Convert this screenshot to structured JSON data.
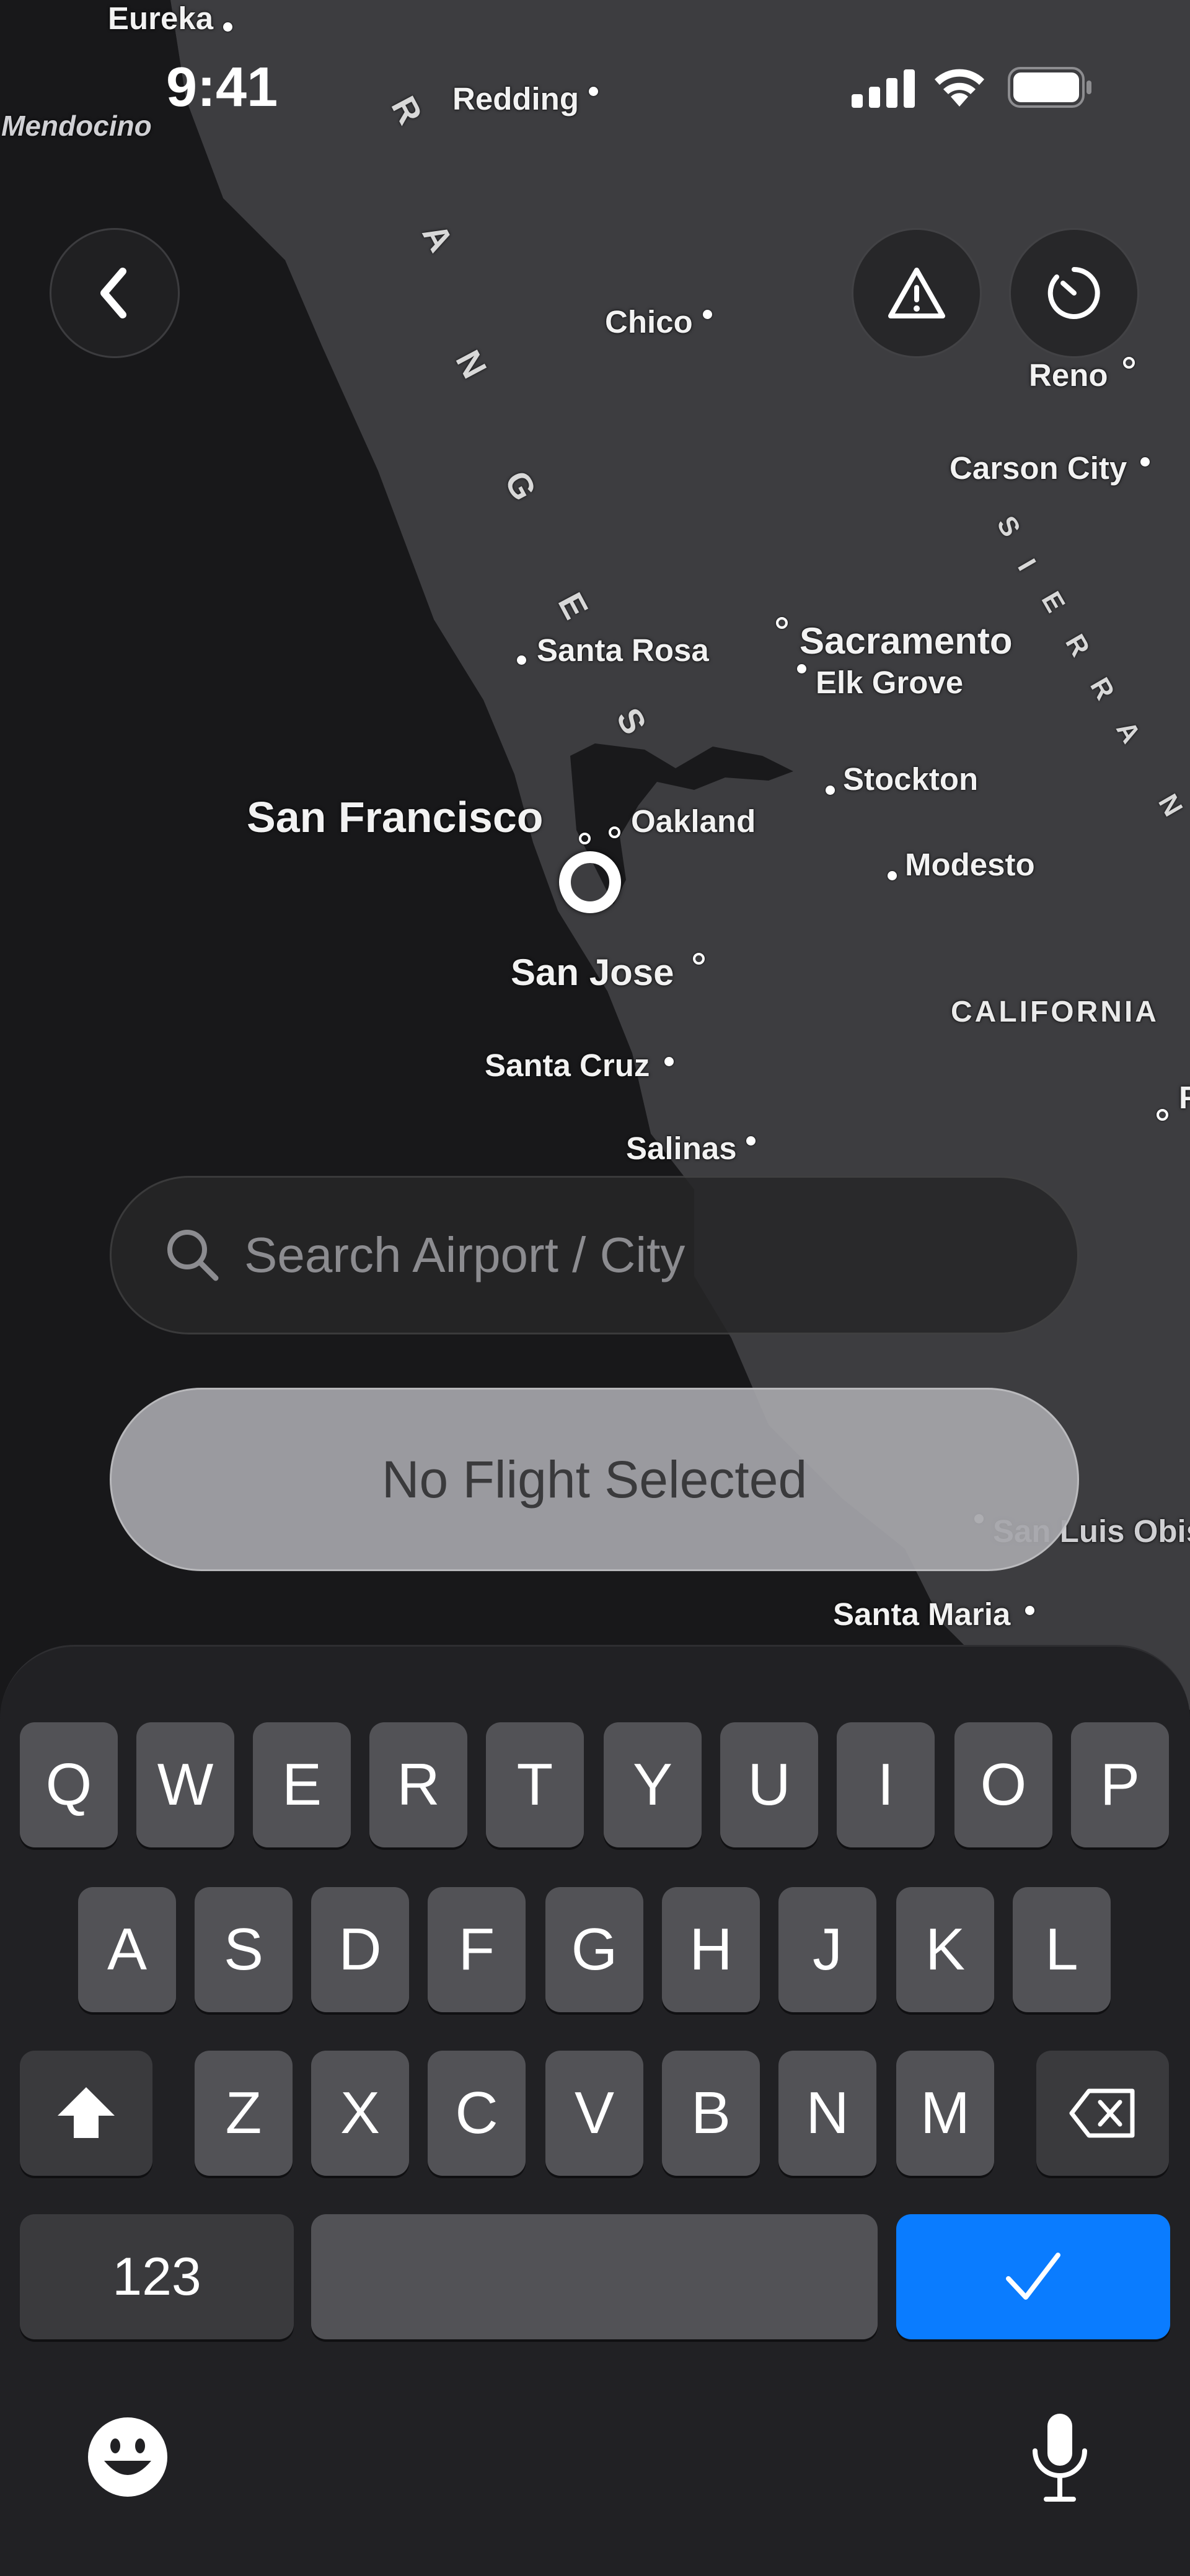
{
  "status_bar": {
    "time": "9:41",
    "icons": [
      "signal-icon",
      "wifi-icon",
      "battery-icon"
    ]
  },
  "map": {
    "cities": [
      {
        "id": "eureka",
        "name": "Eureka"
      },
      {
        "id": "mendocino",
        "name": "Mendocino"
      },
      {
        "id": "redding",
        "name": "Redding"
      },
      {
        "id": "chico",
        "name": "Chico"
      },
      {
        "id": "reno",
        "name": "Reno"
      },
      {
        "id": "carson-city",
        "name": "Carson City"
      },
      {
        "id": "santa-rosa",
        "name": "Santa Rosa"
      },
      {
        "id": "sacramento",
        "name": "Sacramento"
      },
      {
        "id": "elk-grove",
        "name": "Elk Grove"
      },
      {
        "id": "stockton",
        "name": "Stockton"
      },
      {
        "id": "san-francisco",
        "name": "San Francisco"
      },
      {
        "id": "oakland",
        "name": "Oakland"
      },
      {
        "id": "modesto",
        "name": "Modesto"
      },
      {
        "id": "san-jose",
        "name": "San Jose"
      },
      {
        "id": "california",
        "name": "CALIFORNIA"
      },
      {
        "id": "santa-cruz",
        "name": "Santa Cruz"
      },
      {
        "id": "salinas",
        "name": "Salinas"
      },
      {
        "id": "fresno-partial",
        "name": "F"
      },
      {
        "id": "san-luis-obispo",
        "name": "San Luis Obis"
      },
      {
        "id": "santa-maria",
        "name": "Santa Maria"
      }
    ],
    "coast_ranges_letters": [
      "R",
      "A",
      "N",
      "G",
      "E",
      "S"
    ],
    "sierra_letters": [
      "S",
      "I",
      "E",
      "R",
      "R",
      "A",
      "N"
    ]
  },
  "controls": {
    "back_icon": "chevron-left-icon",
    "alert_icon": "warning-triangle-icon",
    "history_icon": "clock-icon"
  },
  "search": {
    "placeholder": "Search Airport / City",
    "value": "",
    "icon": "search-icon"
  },
  "flight_status": {
    "label": "No Flight Selected"
  },
  "keyboard": {
    "row1": [
      "Q",
      "W",
      "E",
      "R",
      "T",
      "Y",
      "U",
      "I",
      "O",
      "P"
    ],
    "row2": [
      "A",
      "S",
      "D",
      "F",
      "G",
      "H",
      "J",
      "K",
      "L"
    ],
    "row3": [
      "Z",
      "X",
      "C",
      "V",
      "B",
      "N",
      "M"
    ],
    "numbers_label": "123",
    "shift_icon": "shift-icon",
    "delete_icon": "delete-icon",
    "done_icon": "checkmark-icon",
    "emoji_icon": "emoji-icon",
    "mic_icon": "microphone-icon",
    "accent_color": "#0a7cff"
  }
}
